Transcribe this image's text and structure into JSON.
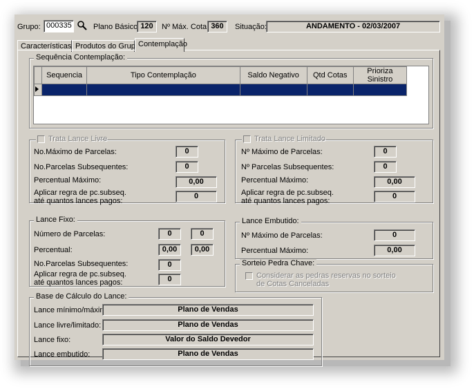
{
  "header": {
    "grupo_label": "Grupo:",
    "grupo_value": "000335",
    "plano_basico_label": "Plano Básico:",
    "plano_basico_value": "120",
    "max_cota_label": "Nº Máx. Cota:",
    "max_cota_value": "360",
    "situacao_label": "Situação:",
    "situacao_value": "ANDAMENTO - 02/03/2007"
  },
  "tabs": [
    "Características",
    "Produtos do Grupo",
    "Contemplação"
  ],
  "active_tab": "Contemplação",
  "sequencia": {
    "title": "Sequência Contemplação:",
    "columns": [
      "Sequencia",
      "Tipo Contemplação",
      "Saldo Negativo",
      "Qtd Cotas",
      "Prioriza Sinistro"
    ]
  },
  "lance_livre": {
    "title": "Trata Lance Livre",
    "max_parcelas_label": "No.Máximo de Parcelas:",
    "max_parcelas": "0",
    "parcelas_subseq_label": "No.Parcelas Subsequentes:",
    "parcelas_subseq": "0",
    "percentual_label": "Percentual Máximo:",
    "percentual": "0,00",
    "regra_label_1": "Aplicar regra de pc.subseq.",
    "regra_label_2": "até quantos lances pagos:",
    "regra": "0"
  },
  "lance_limitado": {
    "title": "Trata Lance Limitado",
    "max_parcelas_label": "Nº Máximo de Parcelas:",
    "max_parcelas": "0",
    "parcelas_subseq_label": "Nº Parcelas Subsequentes:",
    "parcelas_subseq": "0",
    "percentual_label": "Percentual Máximo:",
    "percentual": "0,00",
    "regra_label_1": "Aplicar regra de pc.subseq.",
    "regra_label_2": "até quantos lances pagos:",
    "regra": "0"
  },
  "lance_fixo": {
    "title": "Lance Fixo:",
    "num_parcelas_label": "Número de Parcelas:",
    "num_parcelas_1": "0",
    "num_parcelas_2": "0",
    "percentual_label": "Percentual:",
    "percentual_1": "0,00",
    "percentual_2": "0,00",
    "parcelas_subseq_label": "No.Parcelas Subsequentes:",
    "parcelas_subseq": "0",
    "regra_label_1": "Aplicar regra de pc.subseq.",
    "regra_label_2": "até quantos lances pagos:",
    "regra": "0"
  },
  "lance_embutido": {
    "title": "Lance Embutido:",
    "max_parcelas_label": "Nº Máximo de Parcelas:",
    "max_parcelas": "0",
    "percentual_label": "Percentual Máximo:",
    "percentual": "0,00"
  },
  "sorteio": {
    "title": "Sorteio Pedra Chave:",
    "check_label_1": "Considerar as pedras reservas no sorteio",
    "check_label_2": "de Cotas Canceladas"
  },
  "base_calculo": {
    "title": "Base de Cálculo do Lance:",
    "rows": [
      {
        "label": "Lance mínimo/máximo:",
        "value": "Plano de Vendas"
      },
      {
        "label": "Lance livre/limitado:",
        "value": "Plano de Vendas"
      },
      {
        "label": "Lance fixo:",
        "value": "Valor do Saldo Devedor"
      },
      {
        "label": "Lance embutido:",
        "value": "Plano de Vendas"
      }
    ]
  }
}
